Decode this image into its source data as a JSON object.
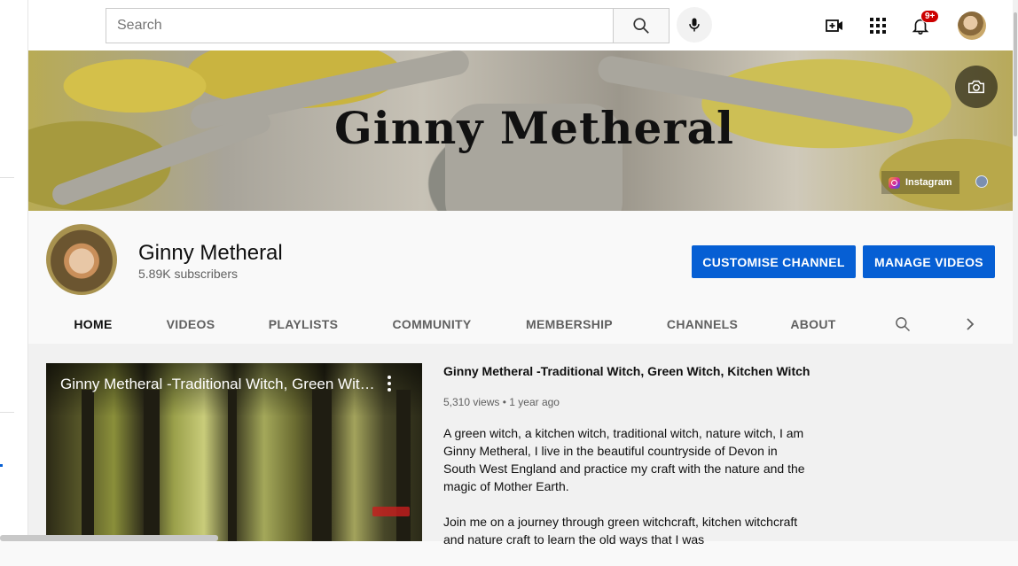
{
  "search": {
    "placeholder": "Search"
  },
  "topbar": {
    "notification_count": "9+"
  },
  "banner": {
    "title": "Ginny Metheral",
    "instagram_label": "Instagram"
  },
  "channel": {
    "name": "Ginny Metheral",
    "subscribers": "5.89K subscribers",
    "customise_label": "CUSTOMISE CHANNEL",
    "manage_label": "MANAGE VIDEOS"
  },
  "tabs": [
    "HOME",
    "VIDEOS",
    "PLAYLISTS",
    "COMMUNITY",
    "MEMBERSHIP",
    "CHANNELS",
    "ABOUT"
  ],
  "featured": {
    "overlay_title": "Ginny Metheral -Traditional Witch, Green Witch, Kitchen Witch",
    "title": "Ginny Metheral -Traditional Witch, Green Witch, Kitchen Witch",
    "views": "5,310 views",
    "separator": "•",
    "age": "1 year ago",
    "description": [
      "A green witch, a kitchen witch,  traditional witch, nature witch, I am Ginny Metheral,   I live in the beautiful countryside of Devon in South West England and practice my craft with the nature and the magic of Mother Earth.",
      "Join me on a journey through green witchcraft, kitchen witchcraft and nature craft to learn the old ways that I was"
    ]
  },
  "colors": {
    "accent": "#065fd4",
    "badge": "#cc0000",
    "text_secondary": "#606060"
  }
}
